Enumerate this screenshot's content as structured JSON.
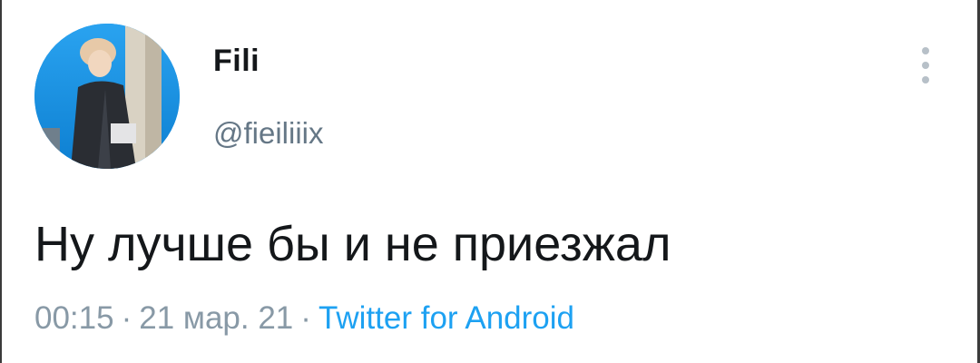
{
  "tweet": {
    "author": {
      "display_name": "Fili",
      "handle": "@fieiliiix",
      "avatar": "profile-photo"
    },
    "more_icon": "vertical-ellipsis-icon",
    "text": "Ну лучше бы и не приезжал",
    "meta": {
      "time": "00:15",
      "separator": "·",
      "date": "21 мар. 21",
      "source": "Twitter for Android"
    }
  },
  "colors": {
    "text_primary": "#14171a",
    "text_secondary": "#657786",
    "meta_gray": "#8899a6",
    "link_blue": "#1da1f2",
    "icon_gray": "#b7c0c8"
  }
}
